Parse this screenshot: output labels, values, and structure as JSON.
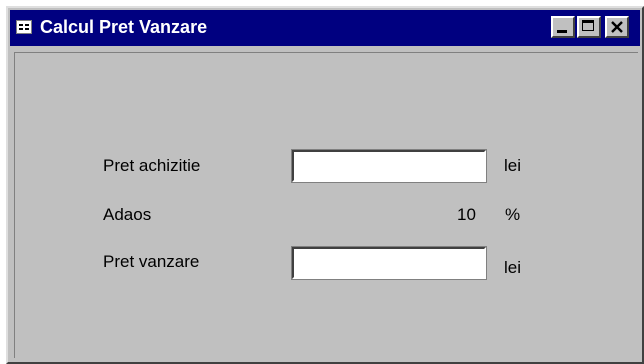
{
  "window": {
    "title": "Calcul Pret Vanzare",
    "icon": "form-icon",
    "controls": [
      "minimize-icon",
      "maximize-icon",
      "close-icon"
    ]
  },
  "form": {
    "pret_achizitie": {
      "label": "Pret achizitie",
      "value": "",
      "unit": "lei"
    },
    "adaos": {
      "label": "Adaos",
      "value": "10",
      "unit": "%"
    },
    "pret_vanzare": {
      "label": "Pret vanzare",
      "value": "",
      "unit": "lei"
    }
  },
  "colors": {
    "titlebar": "#000080",
    "face": "#c0c0c0"
  }
}
